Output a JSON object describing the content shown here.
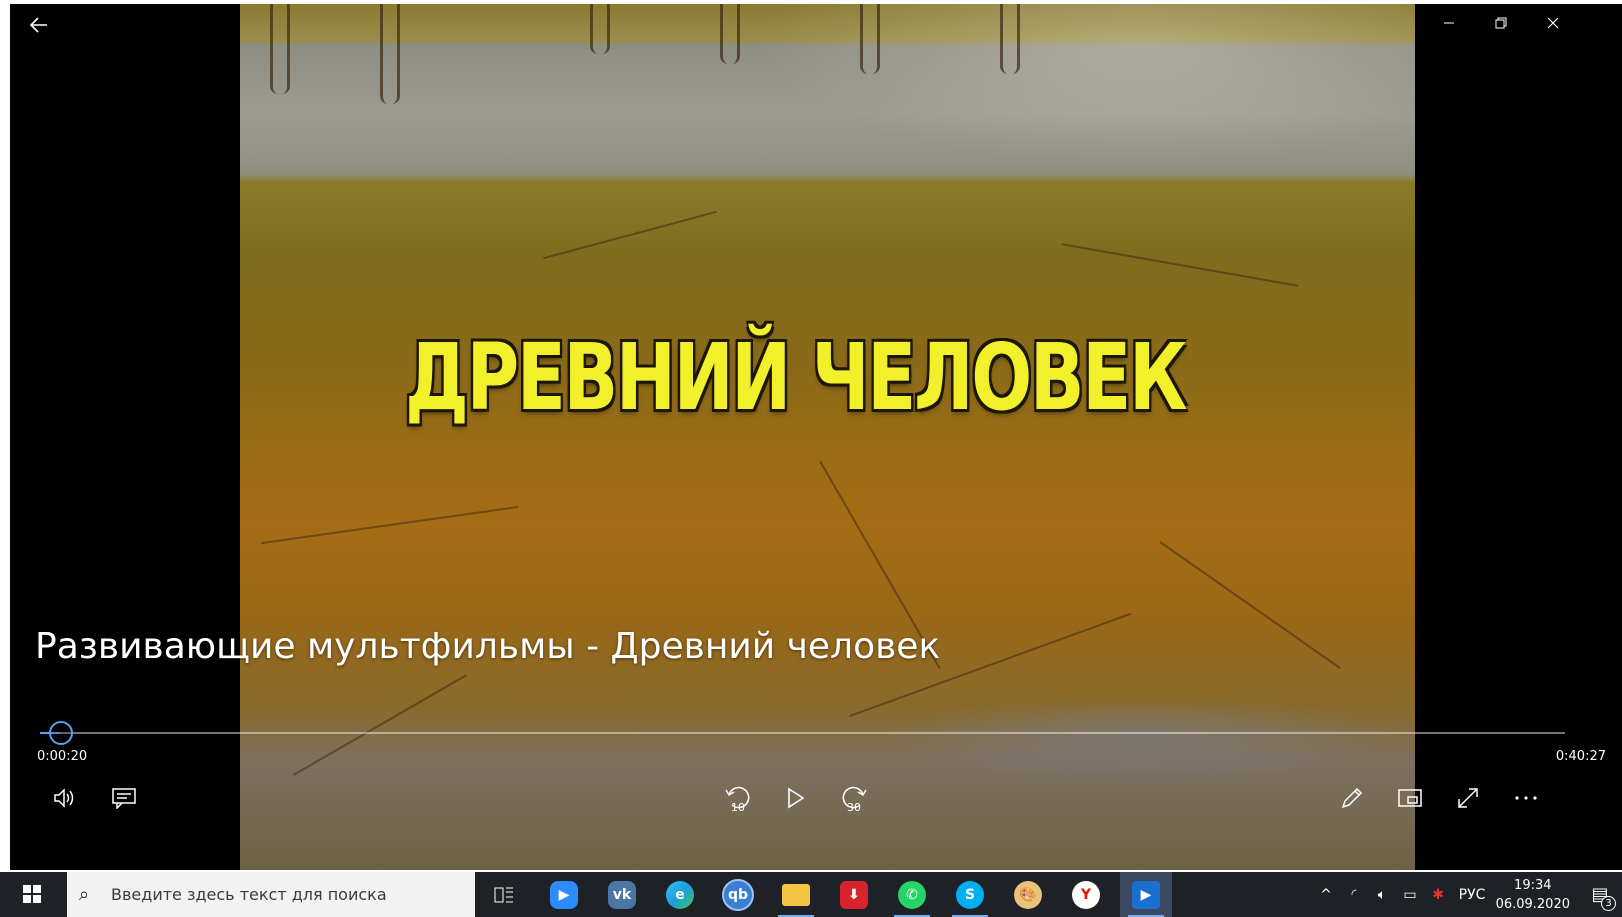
{
  "window": {
    "back_icon": "arrow-left-icon",
    "minimize_icon": "minimize-icon",
    "restore_icon": "restore-icon",
    "close_icon": "close-icon"
  },
  "video": {
    "overlay_text": "ДРЕВНИЙ   ЧЕЛОВЕК"
  },
  "player": {
    "media_title": "Развивающие мультфильмы - Древний человек",
    "current_time": "0:00:20",
    "total_time": "0:40:27",
    "progress_fraction": 0.008,
    "accent_color": "#5aa0f0",
    "skip_back_label": "10",
    "skip_forward_label": "30"
  },
  "taskbar": {
    "search_placeholder": "Введите здесь текст для поиска",
    "language": "РУС",
    "time": "19:34",
    "date": "06.09.2020",
    "notification_count": "3",
    "apps": [
      "task-view",
      "zoom",
      "vk",
      "edge",
      "qbittorrent",
      "file-explorer",
      "downloader",
      "whatsapp",
      "skype",
      "paint",
      "yandex-browser",
      "movies-tv"
    ]
  }
}
